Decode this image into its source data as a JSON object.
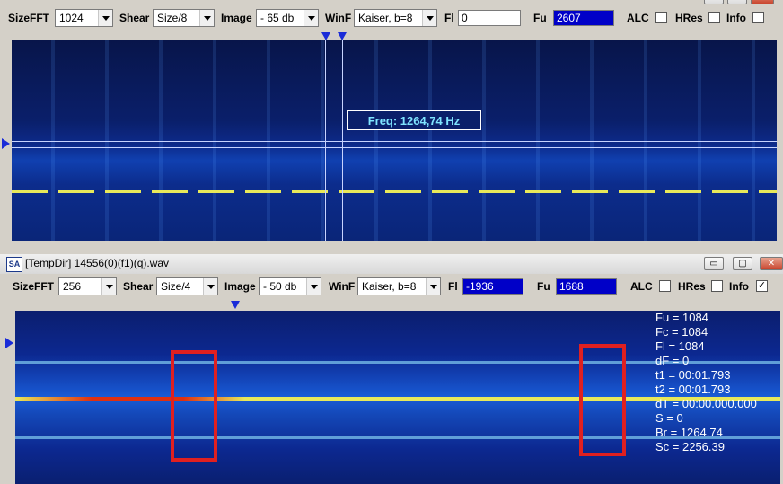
{
  "colors": {
    "accent": "#0000c8",
    "spectrum_bg": "#0a1f6a",
    "marker": "#e02020",
    "line_yellow": "#e8e85a",
    "line_red": "#e03010"
  },
  "window1": {
    "toolbar": {
      "sizefft_label": "SizeFFT",
      "sizefft_value": "1024",
      "shear_label": "Shear",
      "shear_value": "Size/8",
      "image_label": "Image",
      "image_value": "- 65 db",
      "winf_label": "WinF",
      "winf_value": "Kaiser, b=8",
      "fl_label": "Fl",
      "fl_value": "0",
      "fu_label": "Fu",
      "fu_value": "2607",
      "alc_label": "ALC",
      "hres_label": "HRes",
      "info_label": "Info"
    },
    "freq_label": "Freq: 1264,74 Hz"
  },
  "window2": {
    "title": "[TempDir] 14556(0)(f1)(q).wav",
    "icon": "SA",
    "buttons": {
      "minimize": "▭",
      "maximize": "▢",
      "close": "✕"
    },
    "toolbar": {
      "sizefft_label": "SizeFFT",
      "sizefft_value": "256",
      "shear_label": "Shear",
      "shear_value": "Size/4",
      "image_label": "Image",
      "image_value": "- 50 db",
      "winf_label": "WinF",
      "winf_value": "Kaiser, b=8",
      "fl_label": "Fl",
      "fl_value": "-1936",
      "fu_label": "Fu",
      "fu_value": "1688",
      "alc_label": "ALC",
      "hres_label": "HRes",
      "info_label": "Info",
      "info_checked": "✓"
    },
    "readout": [
      "Fu = 1084",
      "Fc = 1084",
      "Fl = 1084",
      "dF = 0",
      "t1 = 00:01.793",
      "t2 = 00:01.793",
      "dT = 00:00.000.000",
      "S = 0",
      "Br = 1264.74",
      "Sc = 2256.39"
    ]
  }
}
